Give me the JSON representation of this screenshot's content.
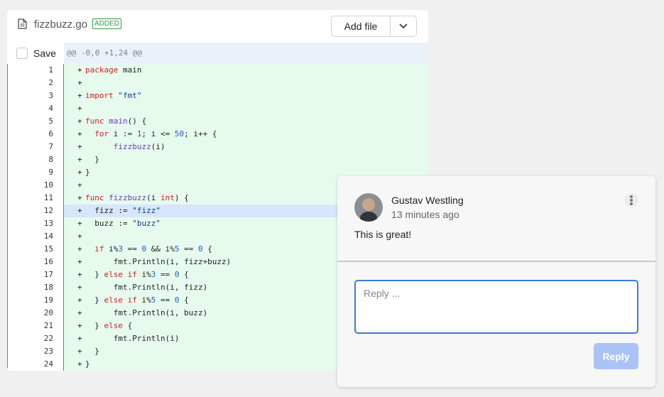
{
  "file": {
    "name": "fizzbuzz.go",
    "status_badge": "ADDED",
    "add_file_label": "Add file",
    "save_label": "Save",
    "hunk_header": "@@ -0,0 +1,24 @@",
    "lines": [
      {
        "num": "1",
        "sign": "+",
        "text": "package main"
      },
      {
        "num": "2",
        "sign": "+",
        "text": ""
      },
      {
        "num": "3",
        "sign": "+",
        "text": "import \"fmt\""
      },
      {
        "num": "4",
        "sign": "+",
        "text": ""
      },
      {
        "num": "5",
        "sign": "+",
        "text": "func main() {"
      },
      {
        "num": "6",
        "sign": "+",
        "text": "  for i := 1; i <= 50; i++ {"
      },
      {
        "num": "7",
        "sign": "+",
        "text": "      fizzbuzz(i)"
      },
      {
        "num": "8",
        "sign": "+",
        "text": "  }"
      },
      {
        "num": "9",
        "sign": "+",
        "text": "}"
      },
      {
        "num": "10",
        "sign": "+",
        "text": ""
      },
      {
        "num": "11",
        "sign": "+",
        "text": "func fizzbuzz(i int) {"
      },
      {
        "num": "12",
        "sign": "+",
        "text": "  fizz := \"fizz\"",
        "highlighted": true
      },
      {
        "num": "13",
        "sign": "+",
        "text": "  buzz := \"buzz\""
      },
      {
        "num": "14",
        "sign": "+",
        "text": ""
      },
      {
        "num": "15",
        "sign": "+",
        "text": "  if i%3 == 0 && i%5 == 0 {"
      },
      {
        "num": "16",
        "sign": "+",
        "text": "      fmt.Println(i, fizz+buzz)"
      },
      {
        "num": "17",
        "sign": "+",
        "text": "  } else if i%3 == 0 {"
      },
      {
        "num": "18",
        "sign": "+",
        "text": "      fmt.Println(i, fizz)"
      },
      {
        "num": "19",
        "sign": "+",
        "text": "  } else if i%5 == 0 {"
      },
      {
        "num": "20",
        "sign": "+",
        "text": "      fmt.Println(i, buzz)"
      },
      {
        "num": "21",
        "sign": "+",
        "text": "  } else {"
      },
      {
        "num": "22",
        "sign": "+",
        "text": "      fmt.Println(i)"
      },
      {
        "num": "23",
        "sign": "+",
        "text": "  }"
      },
      {
        "num": "24",
        "sign": "+",
        "text": "}"
      }
    ]
  },
  "comment": {
    "author": "Gustav Westling",
    "time": "13 minutes ago",
    "body": "This is great!",
    "reply_placeholder": "Reply ...",
    "reply_button": "Reply"
  },
  "colors": {
    "added_bg": "#e6fbee",
    "highlight_bg": "#d7e6fb",
    "accent": "#3d7ad6",
    "badge_green": "#2e9a43"
  }
}
